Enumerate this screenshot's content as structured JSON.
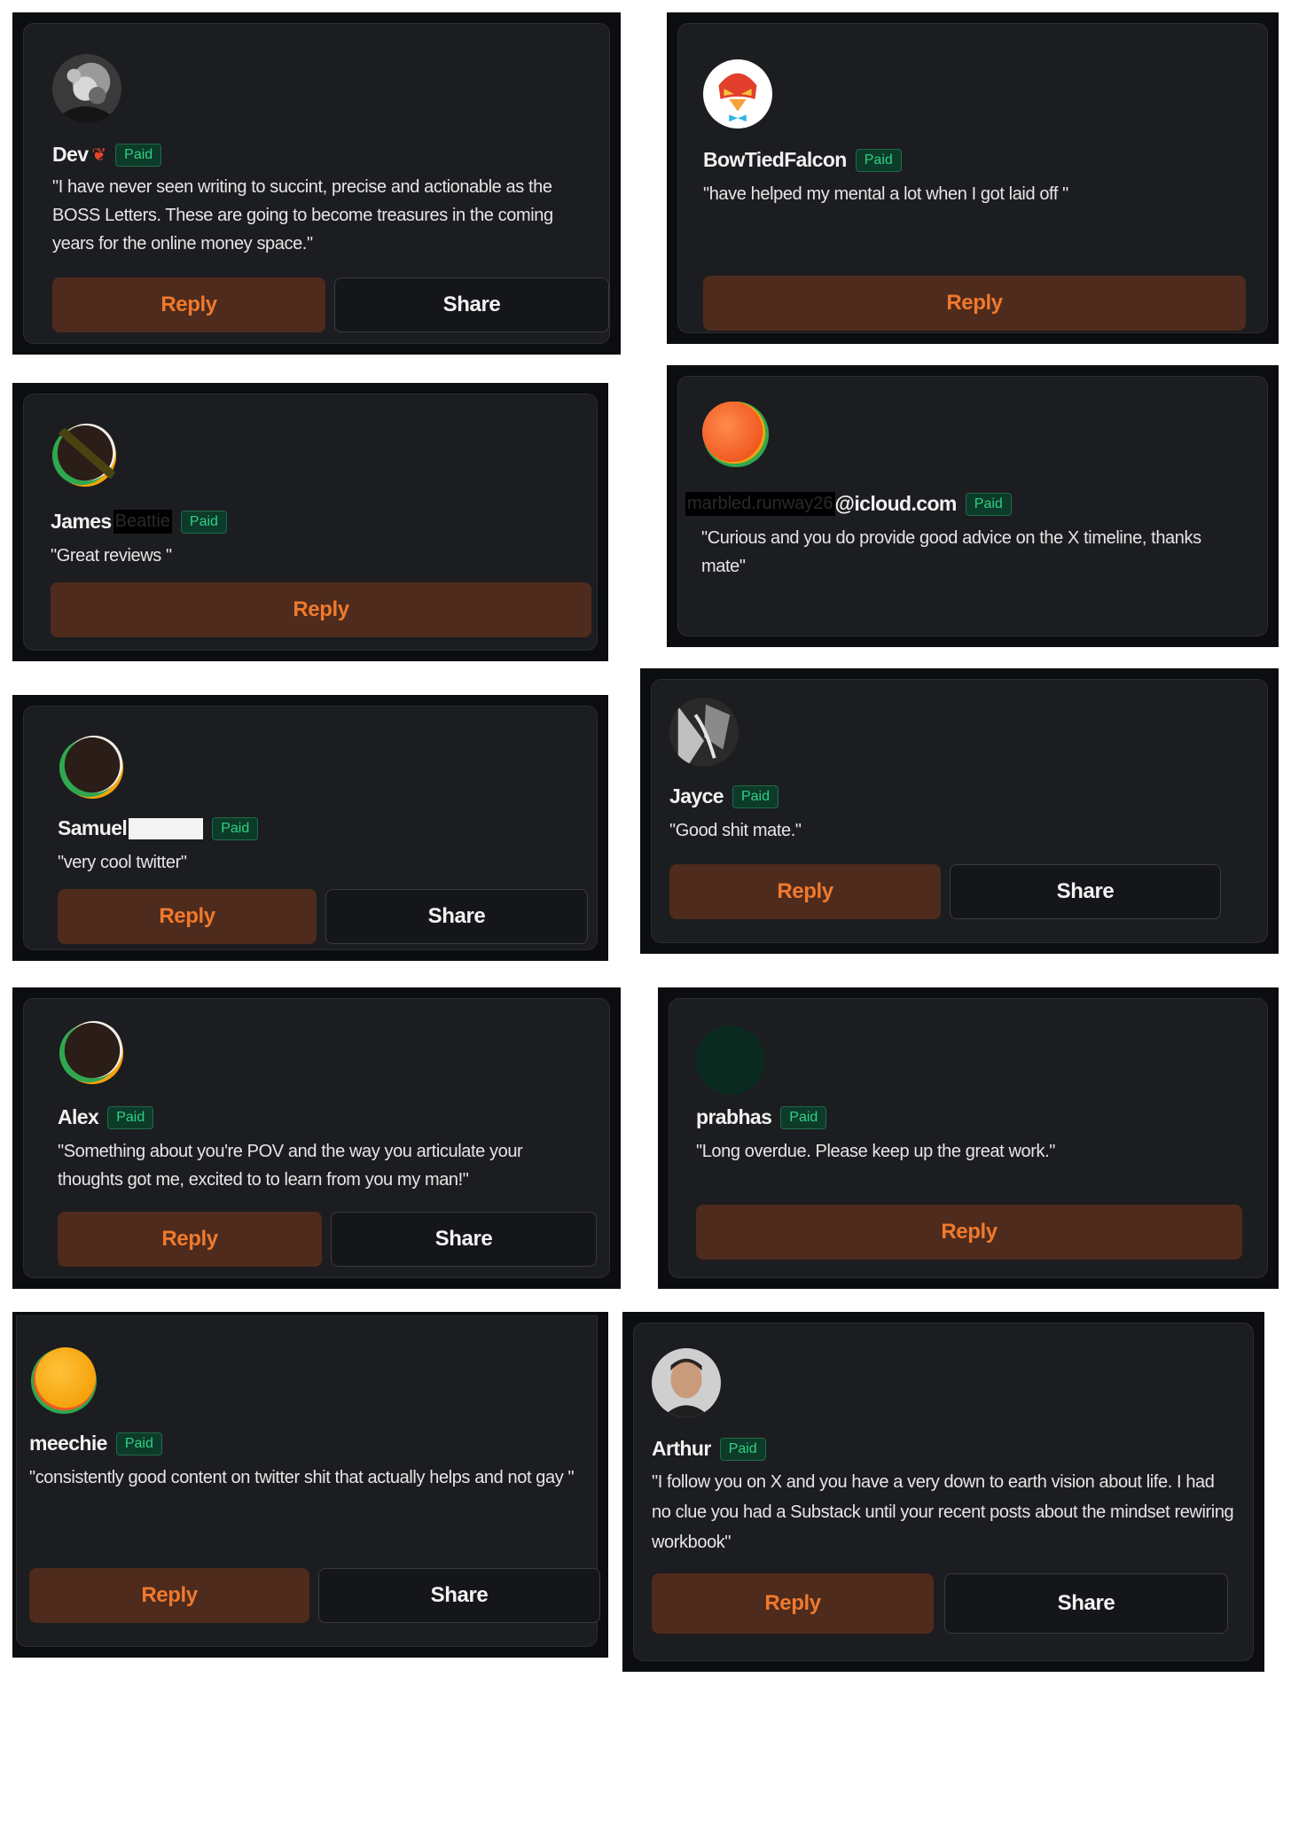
{
  "paid_label": "Paid",
  "reply_label": "Reply",
  "share_label": "Share",
  "colors": {
    "card_bg": "#1c1d20",
    "reply_bg": "#4e2b1c",
    "reply_text": "#f0792c",
    "paid_text": "#2fd085",
    "paid_bg": "#0d3b2a"
  },
  "comments": [
    {
      "name": "Dev",
      "name_suffix_icon": "fire-icon",
      "quote": "\"I have never seen writing to succint, precise and actionable as the BOSS Letters. These are going to become treasures in the coming years for the online money space.\""
    },
    {
      "name": "BowTiedFalcon",
      "quote": "\"have helped my mental a lot when I got laid off \""
    },
    {
      "name": "James",
      "redacted_surname": "Beattie",
      "quote": "\"Great reviews \""
    },
    {
      "name": "@icloud.com",
      "redacted_prefix": "marbled.runway26",
      "quote": "\"Curious and you do provide good advice on the X timeline, thanks mate\""
    },
    {
      "name": "Samuel",
      "quote": "\"very cool twitter\""
    },
    {
      "name": "Jayce",
      "quote": "\"Good shit mate.\""
    },
    {
      "name": "Alex",
      "quote": "\"Something about you're POV and the way you articulate your thoughts got me, excited to to learn from you my man!\""
    },
    {
      "name": "prabhas",
      "quote": "\"Long overdue. Please keep up the great work.\""
    },
    {
      "name": "meechie",
      "quote": "\"consistently good content on twitter shit that actually helps and not gay \""
    },
    {
      "name": "Arthur",
      "quote": "\"I follow you on X and you have a very down to earth vision about life. I had no clue you had a Substack until your recent posts about the mindset rewiring workbook\""
    }
  ]
}
